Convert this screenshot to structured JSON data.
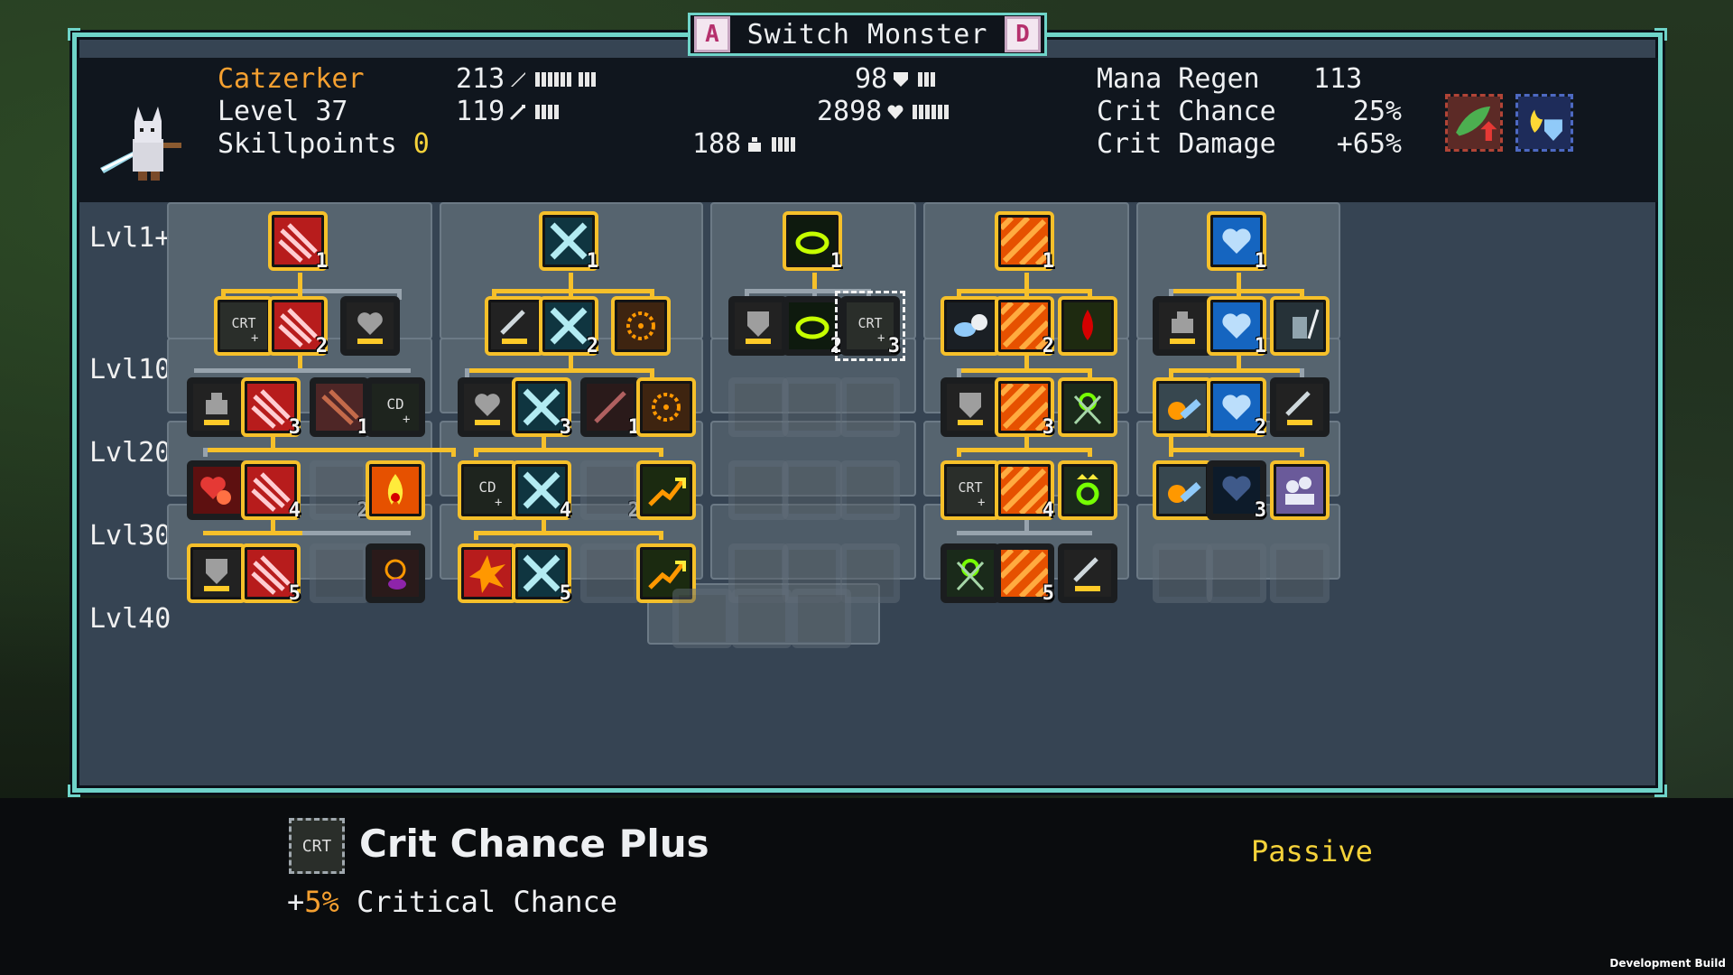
{
  "title_bar": {
    "prev_key": "A",
    "title": "Switch Monster",
    "next_key": "D"
  },
  "monster": {
    "name": "Catzerker",
    "level_label": "Level 37",
    "skillpoints_label": "Skillpoints",
    "skillpoints_value": "0"
  },
  "stats": {
    "attack": "213",
    "magic": "119",
    "defense": "98",
    "health": "2898",
    "mana": "188",
    "mana_regen_label": "Mana Regen",
    "mana_regen_value": "113",
    "crit_chance_label": "Crit Chance",
    "crit_chance_value": "25%",
    "crit_damage_label": "Crit Damage",
    "crit_damage_value": "+65%"
  },
  "level_labels": [
    "Lvl1+",
    "Lvl10+",
    "Lvl20+",
    "Lvl30+",
    "Lvl40"
  ],
  "node_counts": {
    "c1_top": "1",
    "c1_r1": "2",
    "c1_r2": "3",
    "c1_r2b": "1",
    "c1_r3": "4",
    "c1_r3b": "2",
    "c1_r4": "5",
    "c2_top": "1",
    "c2_r1": "2",
    "c2_r2": "3",
    "c2_r2b": "1",
    "c2_r3": "4",
    "c2_r3b": "2",
    "c2_r4": "5",
    "c3_top": "1",
    "c3_r1": "2",
    "c3_r1b": "3",
    "c4_top": "1",
    "c4_r1": "2",
    "c4_r2": "3",
    "c4_r3": "4",
    "c4_r4": "5",
    "c5_top": "1",
    "c5_r1": "1",
    "c5_r2": "2",
    "c5_r3": "3"
  },
  "icon_texts": {
    "crit": "CRT",
    "cooldown": "CD"
  },
  "tooltip": {
    "icon_text": "CRT",
    "title": "Crit Chance Plus",
    "type": "Passive",
    "desc_prefix": "+",
    "desc_value": "5%",
    "desc_rest": " Critical Chance"
  },
  "footer": {
    "dev_build": "Development Build"
  },
  "colors": {
    "accent_teal": "#6fd4c9",
    "node_border": "#f6c02a",
    "name_orange": "#f5a030",
    "highlight_yellow": "#f5d23a"
  }
}
